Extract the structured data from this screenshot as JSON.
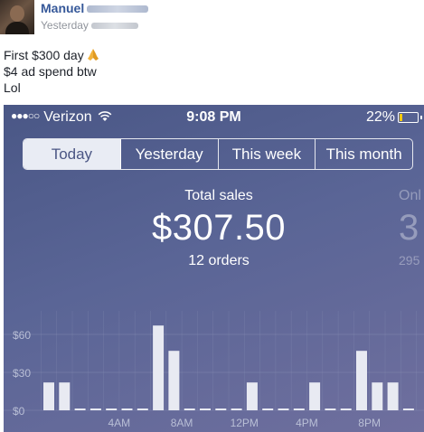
{
  "post": {
    "author_first": "Manuel",
    "timestamp_prefix": "Yesterday",
    "lines": [
      "First $300 day",
      "$4 ad spend btw",
      "Lol"
    ],
    "emoji_icon": "praying-hands-icon"
  },
  "phone": {
    "status": {
      "carrier": "Verizon",
      "time": "9:08 PM",
      "battery": "22%"
    },
    "tabs": [
      "Today",
      "Yesterday",
      "This week",
      "This month"
    ],
    "active_tab": 0,
    "summary": {
      "label": "Total sales",
      "value": "$307.50",
      "sub": "12 orders",
      "next_card_label": "Onl",
      "next_card_value": "3",
      "next_card_sub": "295"
    }
  },
  "chart_data": {
    "type": "bar",
    "ylim": [
      0,
      80
    ],
    "y_ticks": [
      {
        "value": 0,
        "label": "$0"
      },
      {
        "value": 30,
        "label": "$30"
      },
      {
        "value": 60,
        "label": "$60"
      }
    ],
    "x_tick_labels": [
      {
        "hour": 4,
        "label": "4AM"
      },
      {
        "hour": 8,
        "label": "8AM"
      },
      {
        "hour": 12,
        "label": "12PM"
      },
      {
        "hour": 16,
        "label": "4PM"
      },
      {
        "hour": 20,
        "label": "8PM"
      }
    ],
    "hours": [
      0,
      1,
      2,
      3,
      4,
      5,
      6,
      7,
      8,
      9,
      10,
      11,
      12,
      13,
      14,
      15,
      16,
      17,
      18,
      19,
      20,
      21,
      22,
      23
    ],
    "values": [
      22,
      22,
      0,
      0,
      0,
      0,
      0,
      67,
      47,
      0,
      0,
      0,
      0,
      22,
      0,
      0,
      0,
      22,
      0,
      0,
      47,
      22,
      22,
      0
    ],
    "colors": {
      "bar": "#e8eaf2",
      "grid": "#8d95b8",
      "tick_text": "#b9bfd6"
    }
  }
}
